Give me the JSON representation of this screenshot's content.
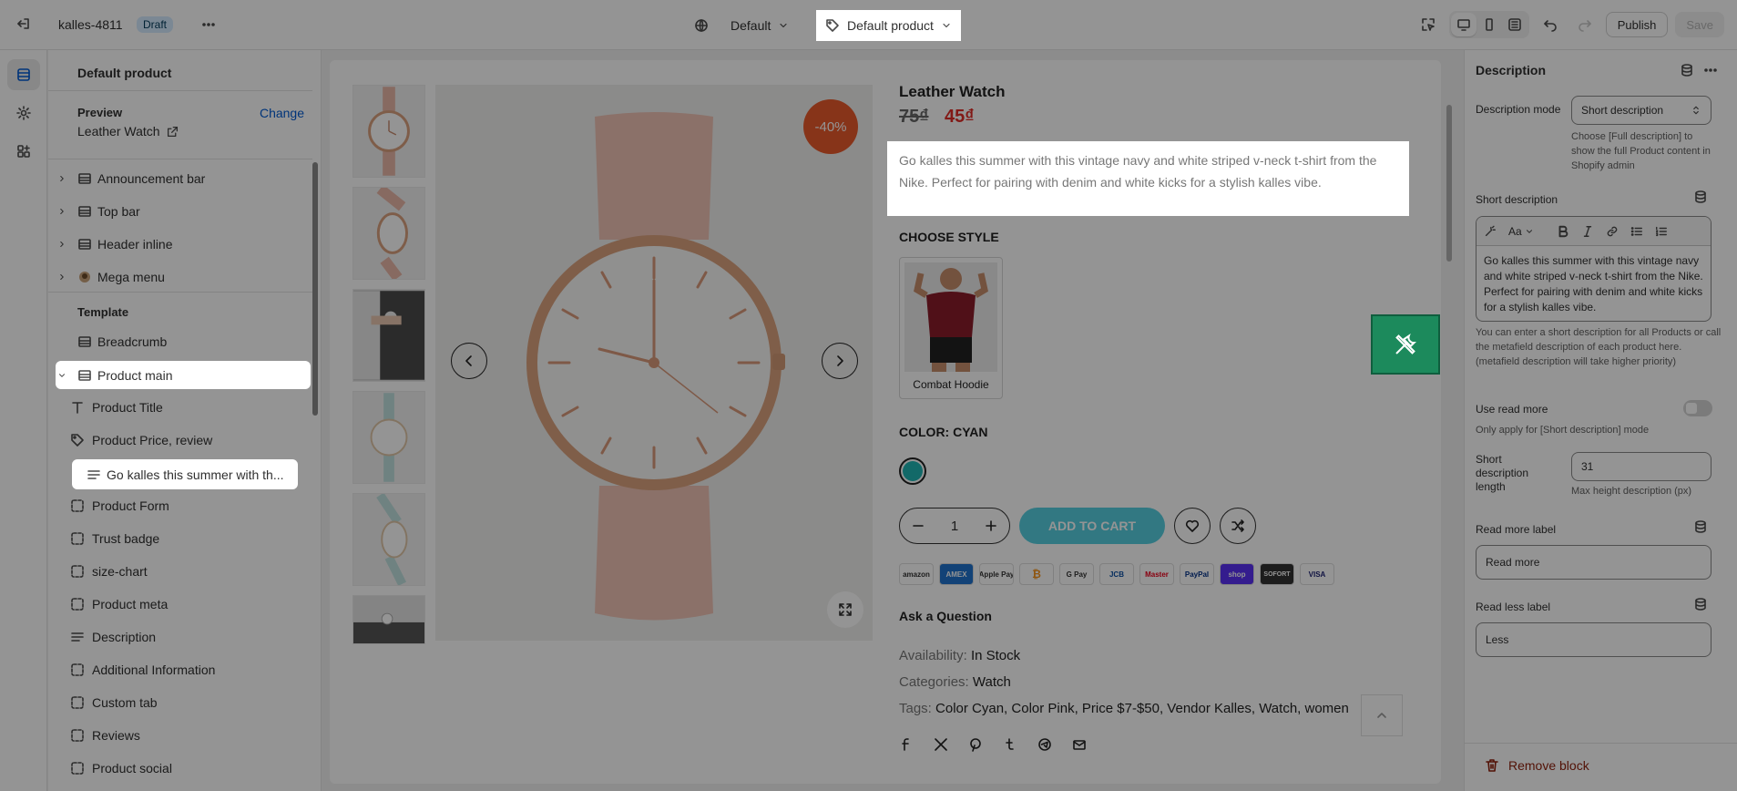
{
  "topbar": {
    "store_name": "kalles-4811",
    "status_badge": "Draft",
    "theme_name": "Default",
    "template_name": "Default product",
    "publish_label": "Publish",
    "save_label": "Save"
  },
  "sidebar": {
    "title": "Default product",
    "preview_label": "Preview",
    "preview_change": "Change",
    "preview_value": "Leather Watch",
    "header_groups": [
      "Announcement bar",
      "Top bar",
      "Header inline",
      "Mega menu"
    ],
    "template_label": "Template",
    "breadcrumb": "Breadcrumb",
    "product_main": "Product main",
    "blocks": [
      {
        "label": "Product Title",
        "icon": "text-icon"
      },
      {
        "label": "Product Price, review",
        "icon": "price-tag-icon"
      },
      {
        "label": "Go kalles this summer with th...",
        "icon": "paragraph-icon"
      },
      {
        "label": "Product Form",
        "icon": "block-icon"
      },
      {
        "label": "Trust badge",
        "icon": "block-icon"
      },
      {
        "label": "size-chart",
        "icon": "block-icon"
      },
      {
        "label": "Product meta",
        "icon": "block-icon"
      },
      {
        "label": "Description",
        "icon": "paragraph-icon"
      },
      {
        "label": "Additional Information",
        "icon": "block-icon"
      },
      {
        "label": "Custom tab",
        "icon": "block-icon"
      },
      {
        "label": "Reviews",
        "icon": "block-icon"
      },
      {
        "label": "Product social",
        "icon": "block-icon"
      }
    ]
  },
  "product": {
    "title": "Leather Watch",
    "price_old": "75₫",
    "price_new": "45₫",
    "sale_badge": "-40%",
    "description": "Go kalles this summer with this vintage navy and white striped v-neck t-shirt from the Nike. Perfect for pairing with denim and white kicks for a stylish kalles vibe.",
    "style_label": "CHOOSE STYLE",
    "style_option": "Combat Hoodie",
    "color_label": "COLOR: CYAN",
    "color_swatch": "#20b5b3",
    "quantity": "1",
    "add_to_cart": "ADD TO CART",
    "payments": [
      "amazon",
      "AMEX",
      "Apple Pay",
      "₿",
      "G Pay",
      "JCB",
      "Master",
      "PayPal",
      "shop",
      "SOFORT",
      "VISA"
    ],
    "ask_question": "Ask a Question",
    "availability_label": "Availability:",
    "availability_value": "In Stock",
    "categories_label": "Categories:",
    "categories_value": "Watch",
    "tags_label": "Tags:",
    "tags_value": "Color Cyan, Color Pink, Price $7-$50, Vendor Kalles, Watch, women"
  },
  "panel": {
    "title": "Description",
    "mode_label": "Description mode",
    "mode_value": "Short description",
    "mode_help": "Choose [Full description] to show the full Product content in Shopify admin",
    "short_desc_label": "Short description",
    "short_desc_value": "Go kalles this summer with this vintage navy and white striped v-neck t-shirt from the Nike. Perfect for pairing with denim and white kicks for a stylish kalles vibe.",
    "short_desc_help": "You can enter a short description for all Products or call the metafield description of each product here. (metafield description will take higher priority)",
    "read_more_toggle_label": "Use read more",
    "read_more_toggle_help": "Only apply for [Short description] mode",
    "length_label": "Short description length",
    "length_value": "31",
    "length_help": "Max height description (px)",
    "read_more_label": "Read more label",
    "read_more_value": "Read more",
    "read_less_label": "Read less label",
    "read_less_value": "Less",
    "remove_block": "Remove block",
    "font_menu": "Aa"
  }
}
